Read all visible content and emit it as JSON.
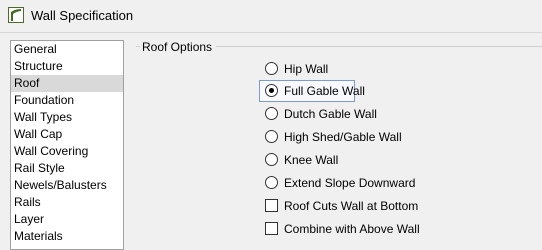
{
  "window": {
    "title": "Wall Specification",
    "icon": "wall-app-icon"
  },
  "sidebar": {
    "items": [
      {
        "label": "General"
      },
      {
        "label": "Structure"
      },
      {
        "label": "Roof",
        "selected": true
      },
      {
        "label": "Foundation"
      },
      {
        "label": "Wall Types"
      },
      {
        "label": "Wall Cap"
      },
      {
        "label": "Wall Covering"
      },
      {
        "label": "Rail Style"
      },
      {
        "label": "Newels/Balusters"
      },
      {
        "label": "Rails"
      },
      {
        "label": "Layer"
      },
      {
        "label": "Materials"
      }
    ]
  },
  "roof_options": {
    "group_title": "Roof Options",
    "radios": [
      {
        "label": "Hip Wall",
        "checked": false
      },
      {
        "label": "Full Gable Wall",
        "checked": true
      },
      {
        "label": "Dutch Gable Wall",
        "checked": false
      },
      {
        "label": "High Shed/Gable Wall",
        "checked": false
      },
      {
        "label": "Knee Wall",
        "checked": false
      },
      {
        "label": "Extend Slope Downward",
        "checked": false
      }
    ],
    "checkboxes": [
      {
        "label": "Roof Cuts Wall at Bottom",
        "checked": false
      },
      {
        "label": "Combine with Above Wall",
        "checked": false
      }
    ]
  }
}
